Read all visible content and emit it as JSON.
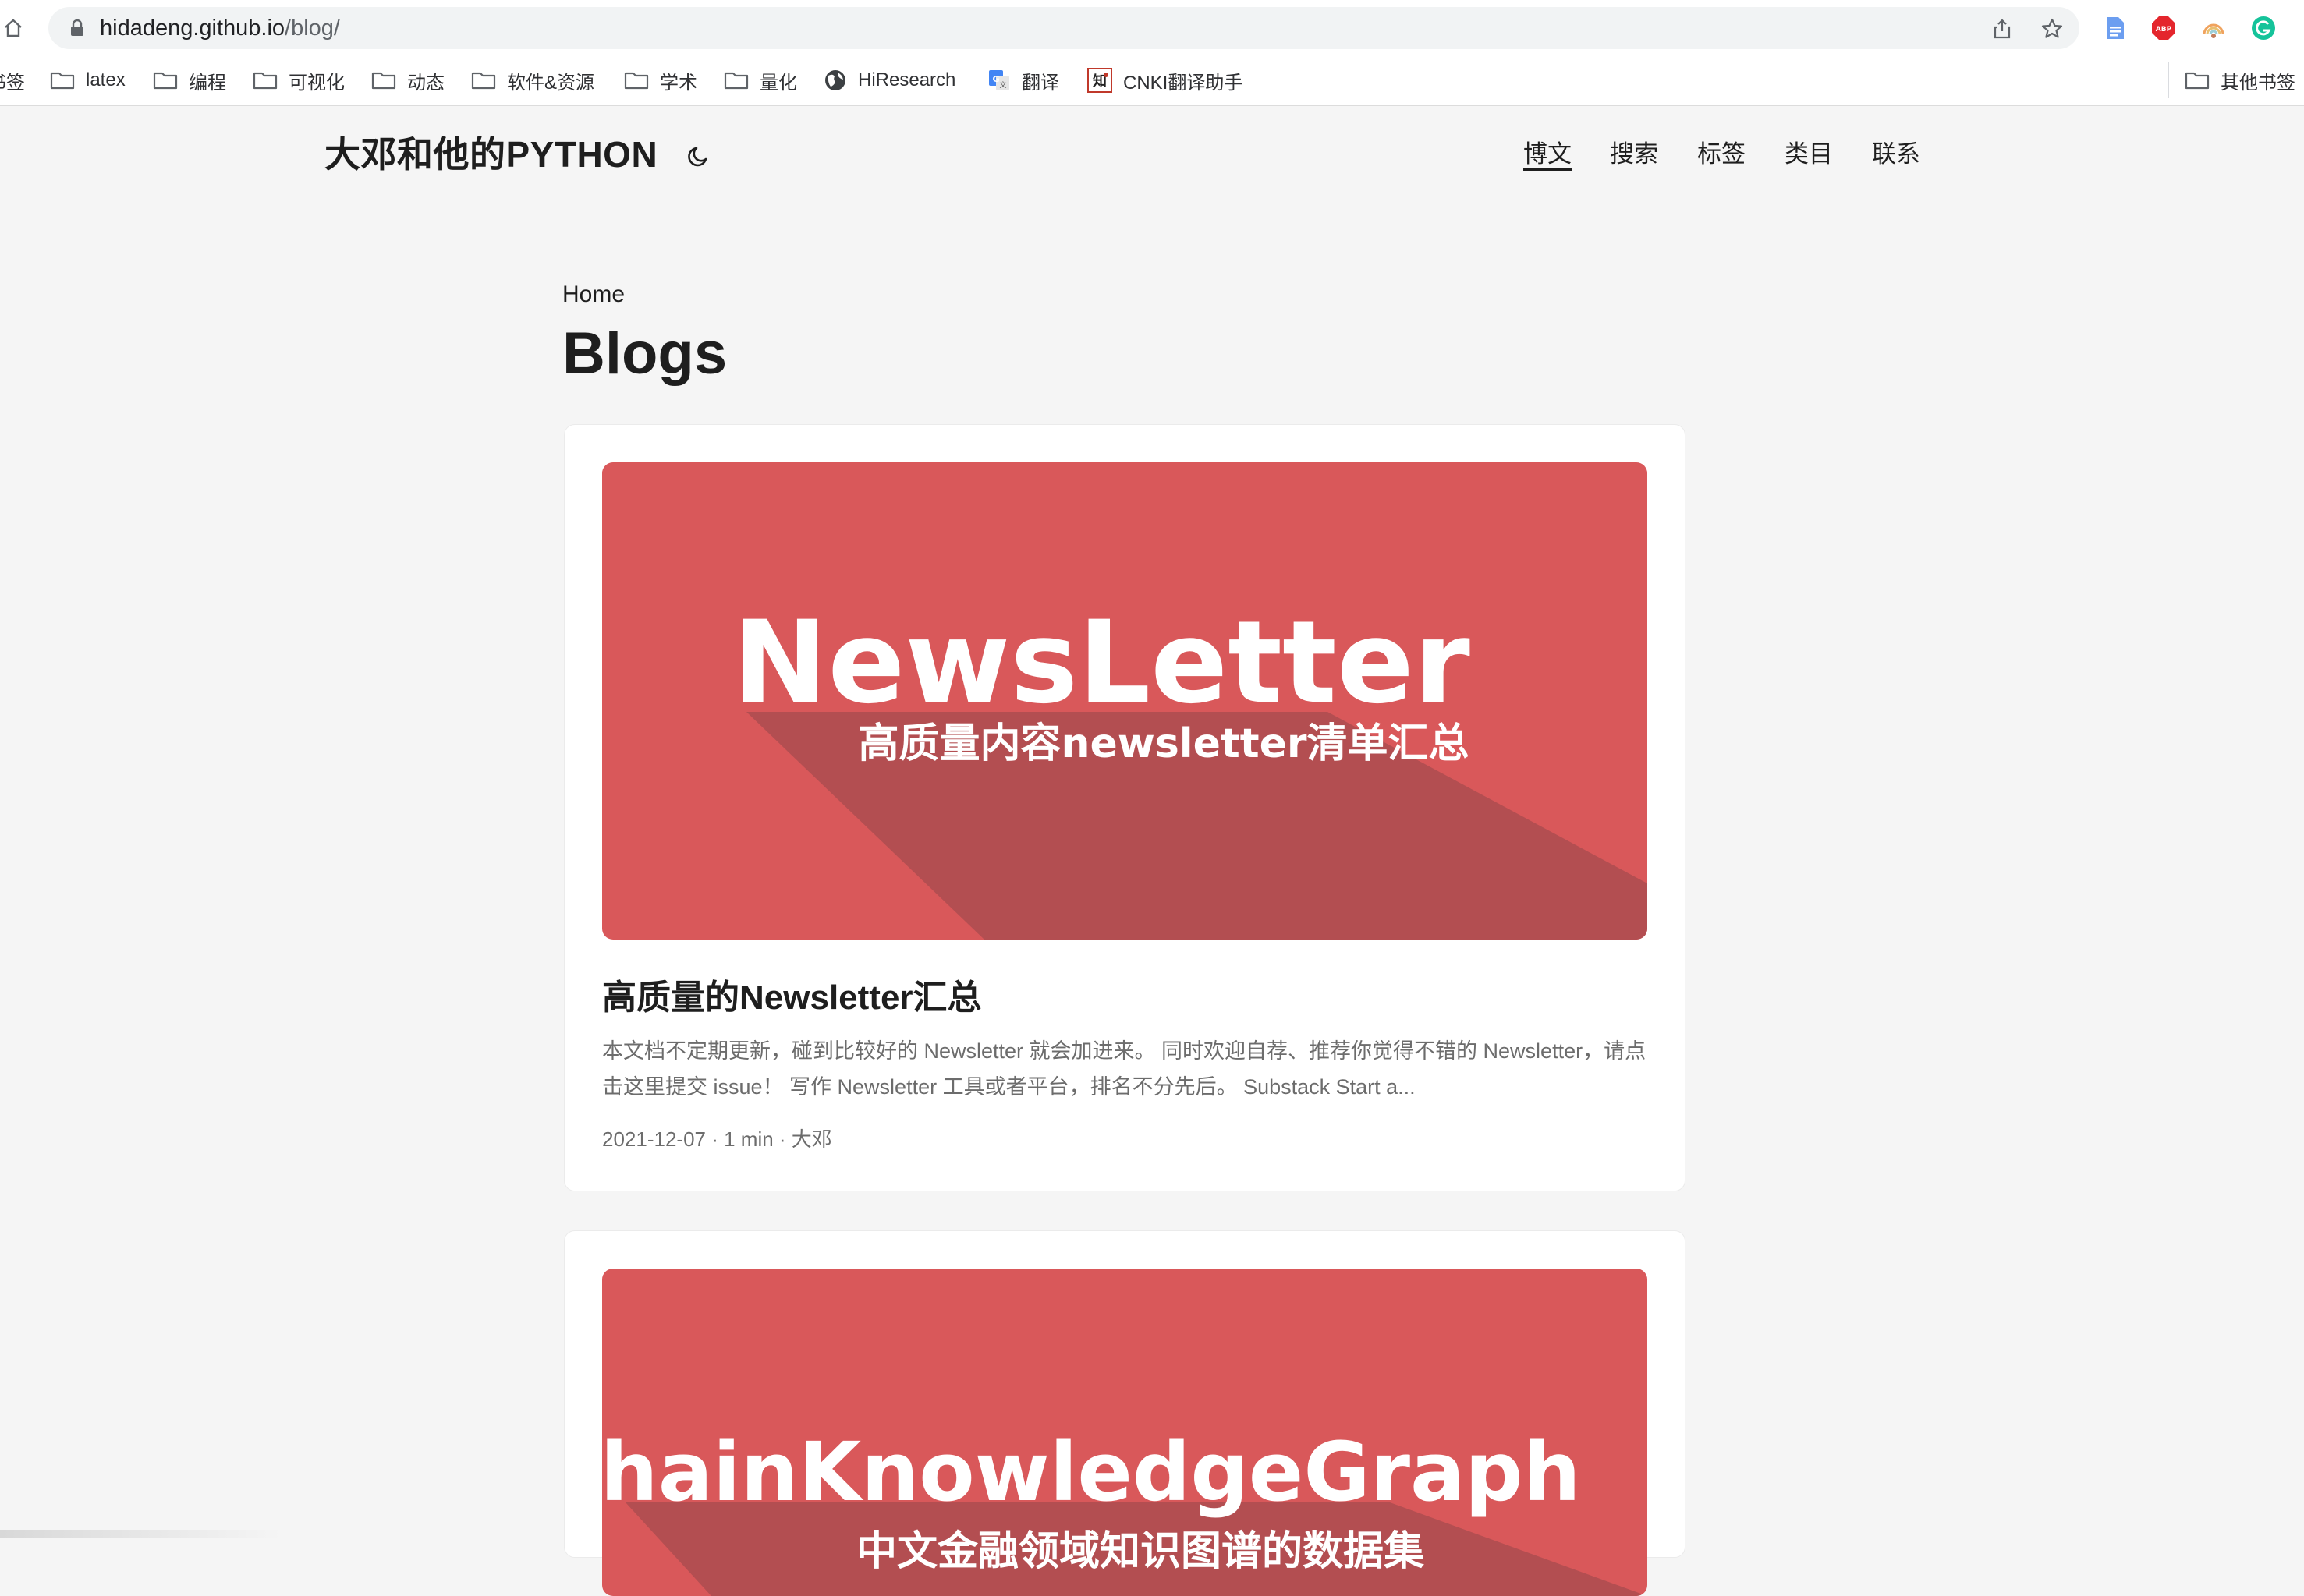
{
  "browser": {
    "url_host": "hidadeng.github.io",
    "url_path": "/blog/",
    "bookmarks": [
      {
        "label": "书签",
        "icon": "folder-icon"
      },
      {
        "label": "latex",
        "icon": "folder-icon"
      },
      {
        "label": "编程",
        "icon": "folder-icon"
      },
      {
        "label": "可视化",
        "icon": "folder-icon"
      },
      {
        "label": "动态",
        "icon": "folder-icon"
      },
      {
        "label": "软件&资源",
        "icon": "folder-icon"
      },
      {
        "label": "学术",
        "icon": "folder-icon"
      },
      {
        "label": "量化",
        "icon": "folder-icon"
      },
      {
        "label": "HiResearch",
        "icon": "globe-icon"
      },
      {
        "label": "翻译",
        "icon": "google-translate-icon"
      },
      {
        "label": "CNKI翻译助手",
        "icon": "cnki-icon"
      }
    ],
    "other_bookmarks": "其他书签",
    "extensions": [
      "docs-icon",
      "adblock-plus-icon",
      "rainbow-extension-icon",
      "grammarly-icon"
    ]
  },
  "site": {
    "title": "大邓和他的PYTHON",
    "theme_icon": "moon-icon",
    "nav": [
      {
        "label": "博文",
        "active": true
      },
      {
        "label": "搜索",
        "active": false
      },
      {
        "label": "标签",
        "active": false
      },
      {
        "label": "类目",
        "active": false
      },
      {
        "label": "联系",
        "active": false
      }
    ]
  },
  "main": {
    "breadcrumb": "Home",
    "title": "Blogs",
    "posts": [
      {
        "cover_title": "NewsLetter",
        "cover_subtitle": "高质量内容newsletter清单汇总",
        "title": "高质量的Newsletter汇总",
        "summary": "本文档不定期更新，碰到比较好的 Newsletter 就会加进来。 同时欢迎自荐、推荐你觉得不错的 Newsletter，请点击这里提交 issue！ 写作 Newsletter 工具或者平台，排名不分先后。 Substack Start a...",
        "meta": "2021-12-07 · 1 min · 大邓"
      },
      {
        "cover_title": "ChainKnowledgeGraph",
        "cover_subtitle": "中文金融领域知识图谱的数据集"
      }
    ]
  },
  "colors": {
    "cover_bg": "#d9585a",
    "cover_shadow": "#b34e51",
    "page_bg": "#f5f5f5"
  }
}
